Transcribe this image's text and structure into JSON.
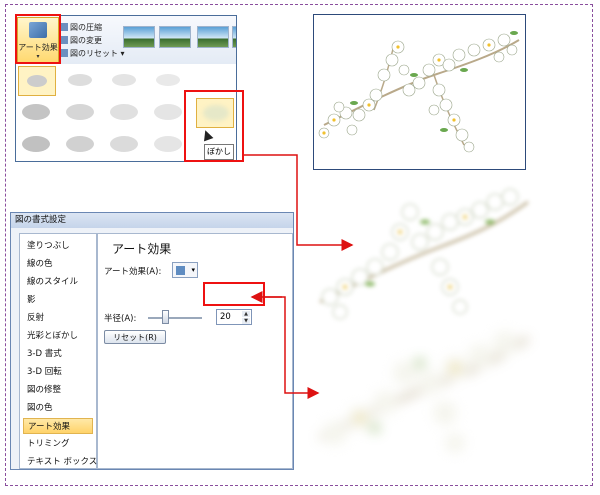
{
  "ribbon": {
    "art_effects_label": "アート効果",
    "art_effects_arrow": "▾",
    "menu": [
      {
        "label": "図の圧縮"
      },
      {
        "label": "図の変更"
      },
      {
        "label": "図のリセット",
        "arrow": "▾"
      }
    ],
    "tooltip": "ぼかし"
  },
  "dialog": {
    "title": "図の書式設定",
    "sidebar": [
      "塗りつぶし",
      "線の色",
      "線のスタイル",
      "影",
      "反射",
      "光彩とぼかし",
      "3-D 書式",
      "3-D 回転",
      "図の修整",
      "図の色",
      "アート効果",
      "トリミング",
      "テキスト ボックス"
    ],
    "selected_index": 10,
    "heading": "アート効果",
    "art_effect_label": "アート効果(A):",
    "radius_label": "半径(A):",
    "radius_value": "20",
    "reset_label": "リセット(R)"
  },
  "colors": {
    "highlight_box": "#ee1111",
    "arrow": "#dd1111",
    "outer_border": "#8a4f9e",
    "selection": "#ffd36a"
  }
}
